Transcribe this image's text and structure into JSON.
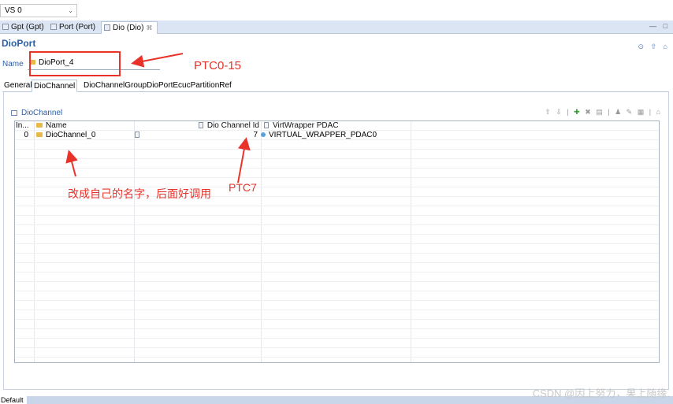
{
  "toolbar": {
    "vs_combo": "VS 0"
  },
  "tabs": [
    {
      "label": "Gpt (Gpt)"
    },
    {
      "label": "Port (Port)"
    },
    {
      "label": "Dio (Dio)"
    }
  ],
  "tab_close": "⌘",
  "window_controls": "— □",
  "page": {
    "title": "DioPort",
    "name_label": "Name",
    "name_value": "DioPort_4"
  },
  "header_icons": "⊙ ⇧ ⌂",
  "subtabs": [
    {
      "label": "General"
    },
    {
      "label": "DioChannel"
    },
    {
      "label": "DioChannelGroup"
    },
    {
      "label": "DioPortEcucPartitionRef"
    }
  ],
  "section": {
    "title": "DioChannel"
  },
  "table_toolbar": {
    "left": "⇧ ⇩ |",
    "add": "✚",
    "right": "✖ ▤ | ♟ ✎ ▦ | ⌂"
  },
  "table": {
    "columns": [
      "In...",
      "Name",
      "Dio Channel Id",
      "VirtWrapper PDAC"
    ],
    "rows": [
      {
        "index": "0",
        "name": "DioChannel_0",
        "channel_id": "7",
        "wrapper": "VIRTUAL_WRAPPER_PDAC0"
      }
    ]
  },
  "annotations": {
    "ptc_range": "PTC0-15",
    "rename_note": "改成自己的名字，后面好调用",
    "ptc7": "PTC7"
  },
  "footer": {
    "default_label": "Default",
    "watermark": "CSDN @因上努力，果上随缘."
  },
  "colors": {
    "accent": "#2d5fa6",
    "annotation_red": "#e8322a",
    "tab_bar": "#dbe5f3"
  }
}
